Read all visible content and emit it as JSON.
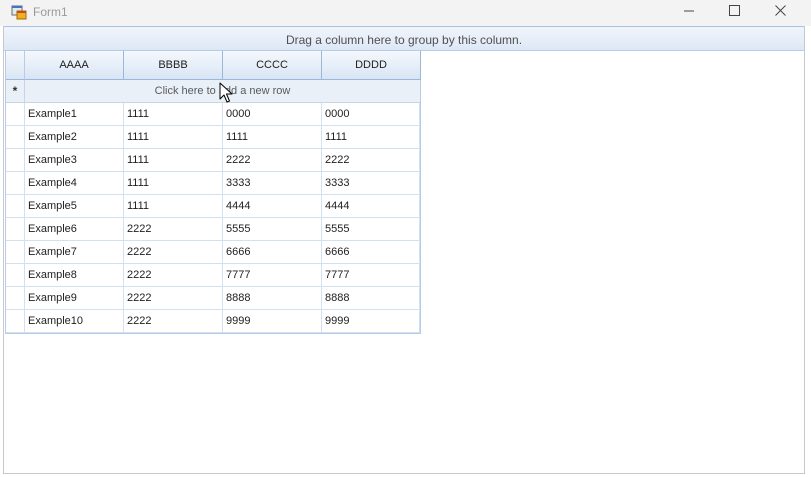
{
  "window": {
    "title": "Form1"
  },
  "groupby": {
    "text": "Drag a column here to group by this column."
  },
  "grid": {
    "columns": [
      "AAAA",
      "BBBB",
      "CCCC",
      "DDDD"
    ],
    "new_row_marker": "*",
    "new_row_text": "Click here to add a new row",
    "rows": [
      [
        "Example1",
        "1111",
        "0000",
        "0000"
      ],
      [
        "Example2",
        "1111",
        "1111",
        "1111"
      ],
      [
        "Example3",
        "1111",
        "2222",
        "2222"
      ],
      [
        "Example4",
        "1111",
        "3333",
        "3333"
      ],
      [
        "Example5",
        "1111",
        "4444",
        "4444"
      ],
      [
        "Example6",
        "2222",
        "5555",
        "5555"
      ],
      [
        "Example7",
        "2222",
        "6666",
        "6666"
      ],
      [
        "Example8",
        "2222",
        "7777",
        "7777"
      ],
      [
        "Example9",
        "2222",
        "8888",
        "8888"
      ],
      [
        "Example10",
        "2222",
        "9999",
        "9999"
      ]
    ]
  },
  "icons": {
    "app": "form-app-icon",
    "minimize": "minimize-icon",
    "maximize": "maximize-icon",
    "close": "close-icon",
    "cursor": "mouse-cursor-icon"
  }
}
